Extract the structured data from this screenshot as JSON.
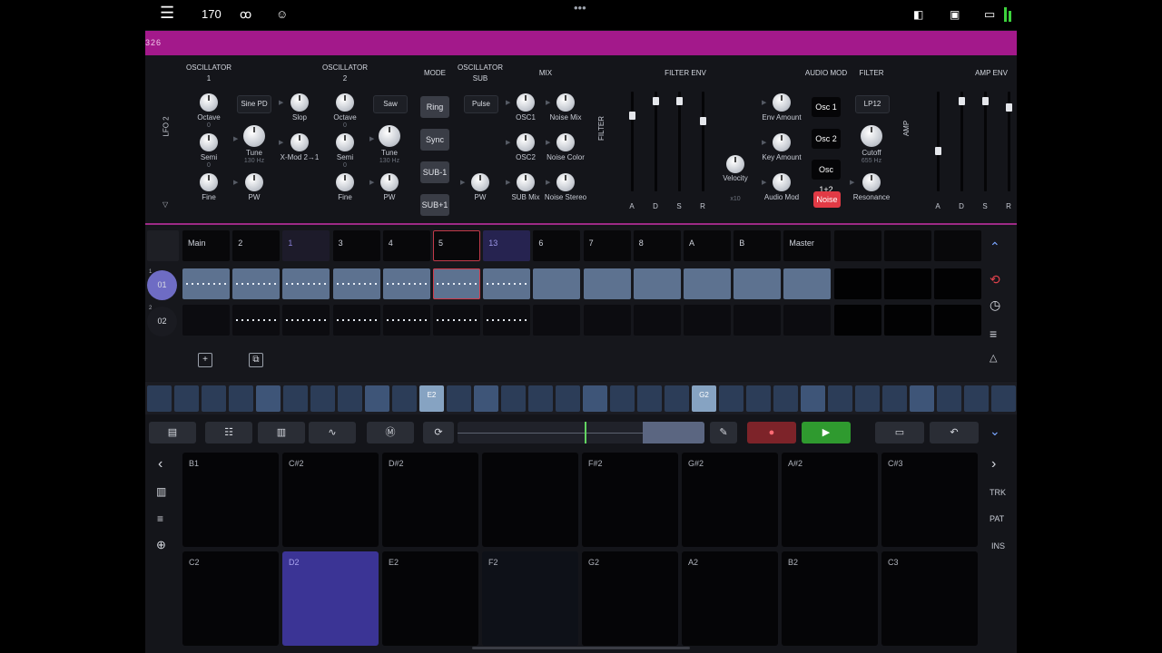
{
  "statusbar": {
    "tempo": "170"
  },
  "header_bar": {
    "text": "326"
  },
  "synth": {
    "headers": {
      "osc1": "OSCILLATOR\n1",
      "osc2": "OSCILLATOR\n2",
      "mode": "MODE",
      "osc_sub": "OSCILLATOR\nSUB",
      "mix": "MIX",
      "filter_env": "FILTER ENV",
      "audio_mod": "AUDIO MOD",
      "filter": "FILTER",
      "amp_env": "AMP ENV"
    },
    "side_labels": {
      "lfo": "LFO 2",
      "filter": "FILTER",
      "amp": "AMP"
    },
    "osc1": {
      "octave": "Octave",
      "octave_val": "0",
      "semi": "Semi",
      "semi_val": "0",
      "fine": "Fine",
      "wave": "Sine PD",
      "tune": "Tune",
      "tune_val": "130 Hz",
      "pw": "PW",
      "slop": "Slop",
      "xmod": "X-Mod 2→1"
    },
    "osc2": {
      "octave": "Octave",
      "octave_val": "0",
      "semi": "Semi",
      "semi_val": "0",
      "fine": "Fine",
      "wave": "Saw",
      "tune": "Tune",
      "tune_val": "130 Hz",
      "pw": "PW"
    },
    "mode_buttons": [
      "Ring",
      "Sync",
      "SUB-1",
      "SUB+1"
    ],
    "sub": {
      "wave": "Pulse",
      "pw": "PW"
    },
    "mix": {
      "osc1": "OSC1",
      "noise_mix": "Noise Mix",
      "osc2": "OSC2",
      "noise_color": "Noise Color",
      "sub_mix": "SUB Mix",
      "noise_stereo": "Noise Stereo"
    },
    "filter_env_letters": [
      "A",
      "D",
      "S",
      "R"
    ],
    "filter_env_levels": [
      0.8,
      0.95,
      0.95,
      0.75
    ],
    "velocity": "Velocity",
    "x10": "x10",
    "audio_mod": {
      "env_amount": "Env Amount",
      "key_amount": "Key Amount",
      "audio_mod": "Audio Mod"
    },
    "osc_buttons": [
      "Osc 1",
      "Osc 2",
      "Osc 1+2",
      "Noise"
    ],
    "filter": {
      "type": "LP12",
      "cutoff": "Cutoff",
      "cutoff_val": "655 Hz",
      "resonance": "Resonance"
    },
    "amp_env_letters": [
      "A",
      "D",
      "S",
      "R"
    ],
    "amp_env_levels": [
      0.45,
      0.95,
      0.95,
      0.88
    ]
  },
  "pattern_grid": {
    "headers": [
      "Main",
      "2",
      "1",
      "3",
      "4",
      "5",
      "13",
      "6",
      "7",
      "8",
      "A",
      "B",
      "Master",
      "",
      "",
      ""
    ],
    "tracks": [
      {
        "tag": "1",
        "label": "01"
      },
      {
        "tag": "2",
        "label": "02"
      }
    ]
  },
  "keyboard_strip": {
    "e2": "E2",
    "g2": "G2"
  },
  "pads": {
    "top": [
      "B1",
      "C#2",
      "D#2",
      "",
      "F#2",
      "G#2",
      "A#2",
      "C#3"
    ],
    "bottom": [
      "C2",
      "D2",
      "E2",
      "F2",
      "G2",
      "A2",
      "B2",
      "C3"
    ]
  },
  "right_side": {
    "trk": "TRK",
    "pat": "PAT",
    "ins": "INS"
  }
}
